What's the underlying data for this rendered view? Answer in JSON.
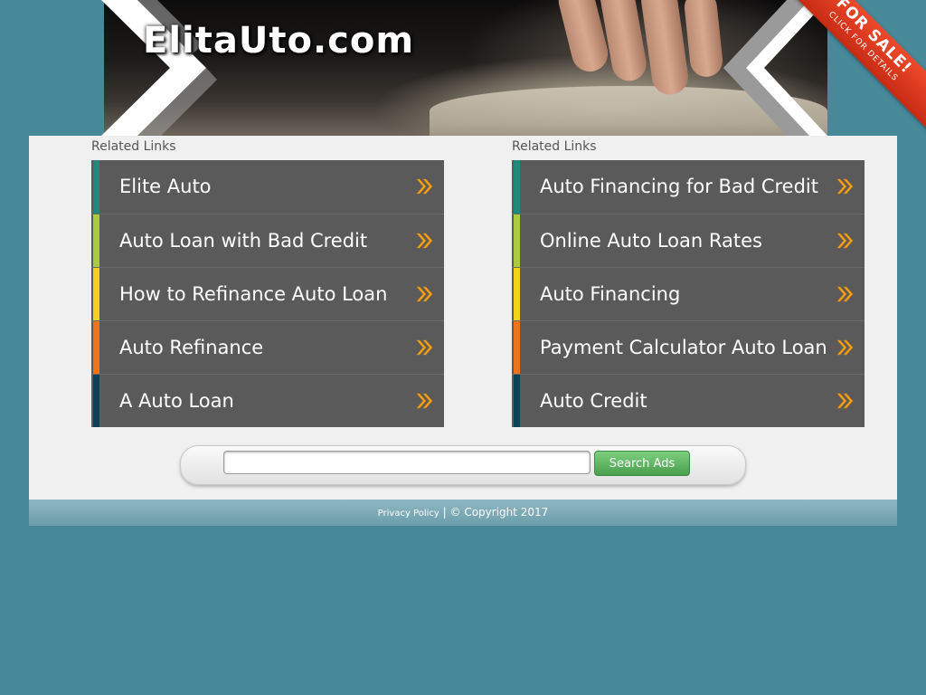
{
  "header": {
    "site_title": "ElitaUto.com",
    "for_sale_label": "FOR SALE!",
    "for_sale_sub": "CLICK FOR DETAILS"
  },
  "related": {
    "left": {
      "title": "Related Links",
      "items": [
        {
          "label": "Elite Auto",
          "color": "#1e8a7a"
        },
        {
          "label": "Auto Loan with Bad Credit",
          "color": "#a9cc3b"
        },
        {
          "label": "How to Refinance Auto Loan",
          "color": "#f2d21e"
        },
        {
          "label": "Auto Refinance",
          "color": "#ef7417"
        },
        {
          "label": "A Auto Loan",
          "color": "#0d4158"
        }
      ]
    },
    "right": {
      "title": "Related Links",
      "items": [
        {
          "label": "Auto Financing for Bad Credit",
          "color": "#1e8a7a"
        },
        {
          "label": "Online Auto Loan Rates",
          "color": "#a9cc3b"
        },
        {
          "label": "Auto Financing",
          "color": "#f2d21e"
        },
        {
          "label": "Payment Calculator Auto Loan",
          "color": "#ef7417"
        },
        {
          "label": "Auto Credit",
          "color": "#0d4158"
        }
      ]
    }
  },
  "search": {
    "value": "",
    "button_label": "Search Ads"
  },
  "footer": {
    "privacy_label": "Privacy Policy",
    "separator": "|",
    "copyright": "© Copyright 2017"
  },
  "colors": {
    "page_bg": "#478999",
    "panel_bg": "#f0f0f0",
    "item_bg": "#5a5a5a",
    "arrow": "#f4a623",
    "for_sale_bg": "#e23a1f"
  }
}
